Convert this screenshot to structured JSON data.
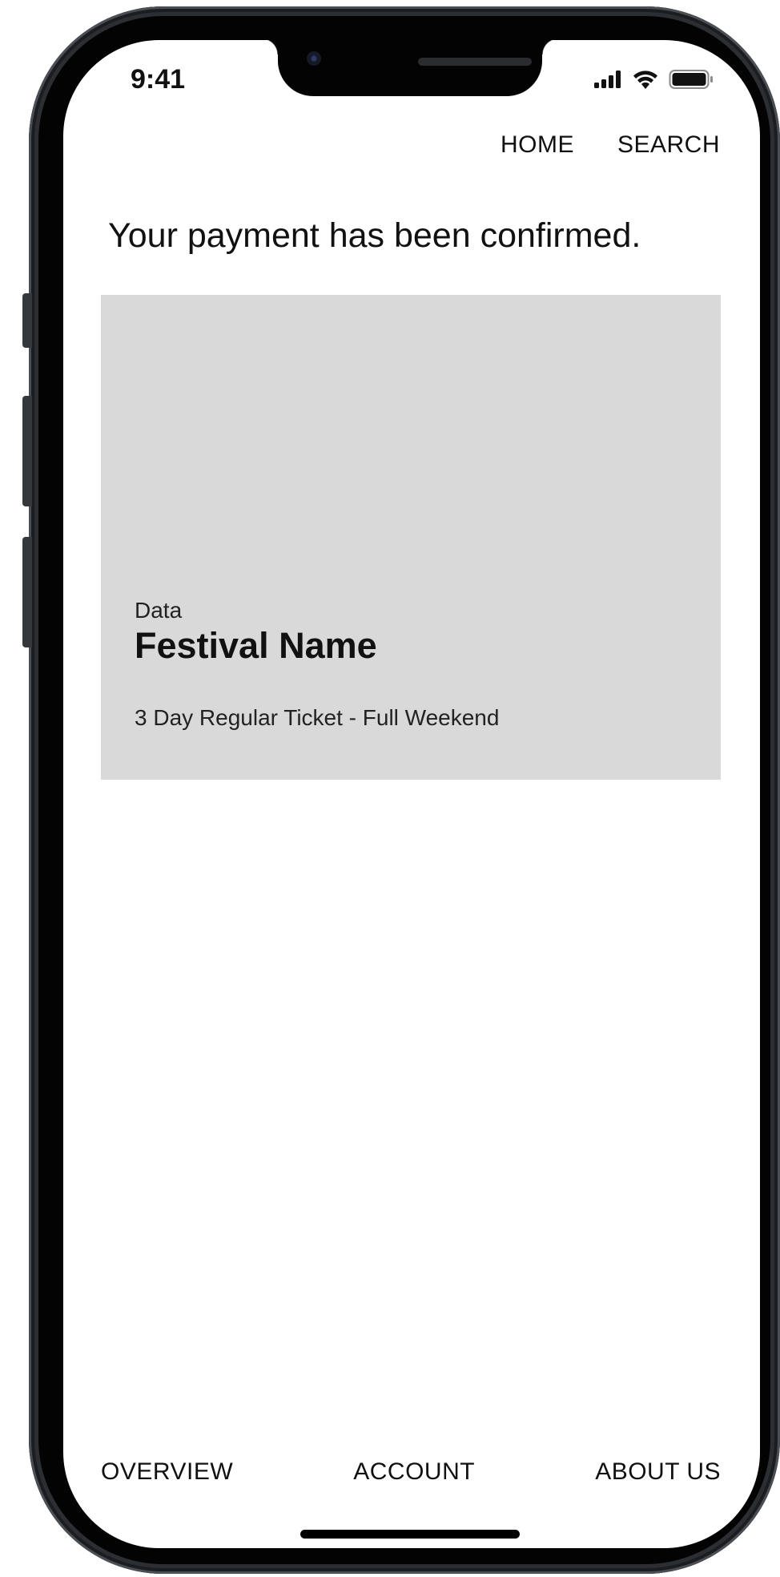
{
  "status_bar": {
    "time": "9:41",
    "icons": [
      "cellular-signal-icon",
      "wifi-icon",
      "battery-icon"
    ]
  },
  "top_nav": {
    "home_label": "HOME",
    "search_label": "SEARCH"
  },
  "confirmation": {
    "message": "Your payment has been confirmed."
  },
  "ticket": {
    "date": "Data",
    "festival_name": "Festival Name",
    "ticket_type": "3 Day Regular Ticket - Full Weekend",
    "card_color": "#d9d9d9"
  },
  "bottom_nav": {
    "overview_label": "OVERVIEW",
    "account_label": "ACCOUNT",
    "about_label": "ABOUT US"
  }
}
